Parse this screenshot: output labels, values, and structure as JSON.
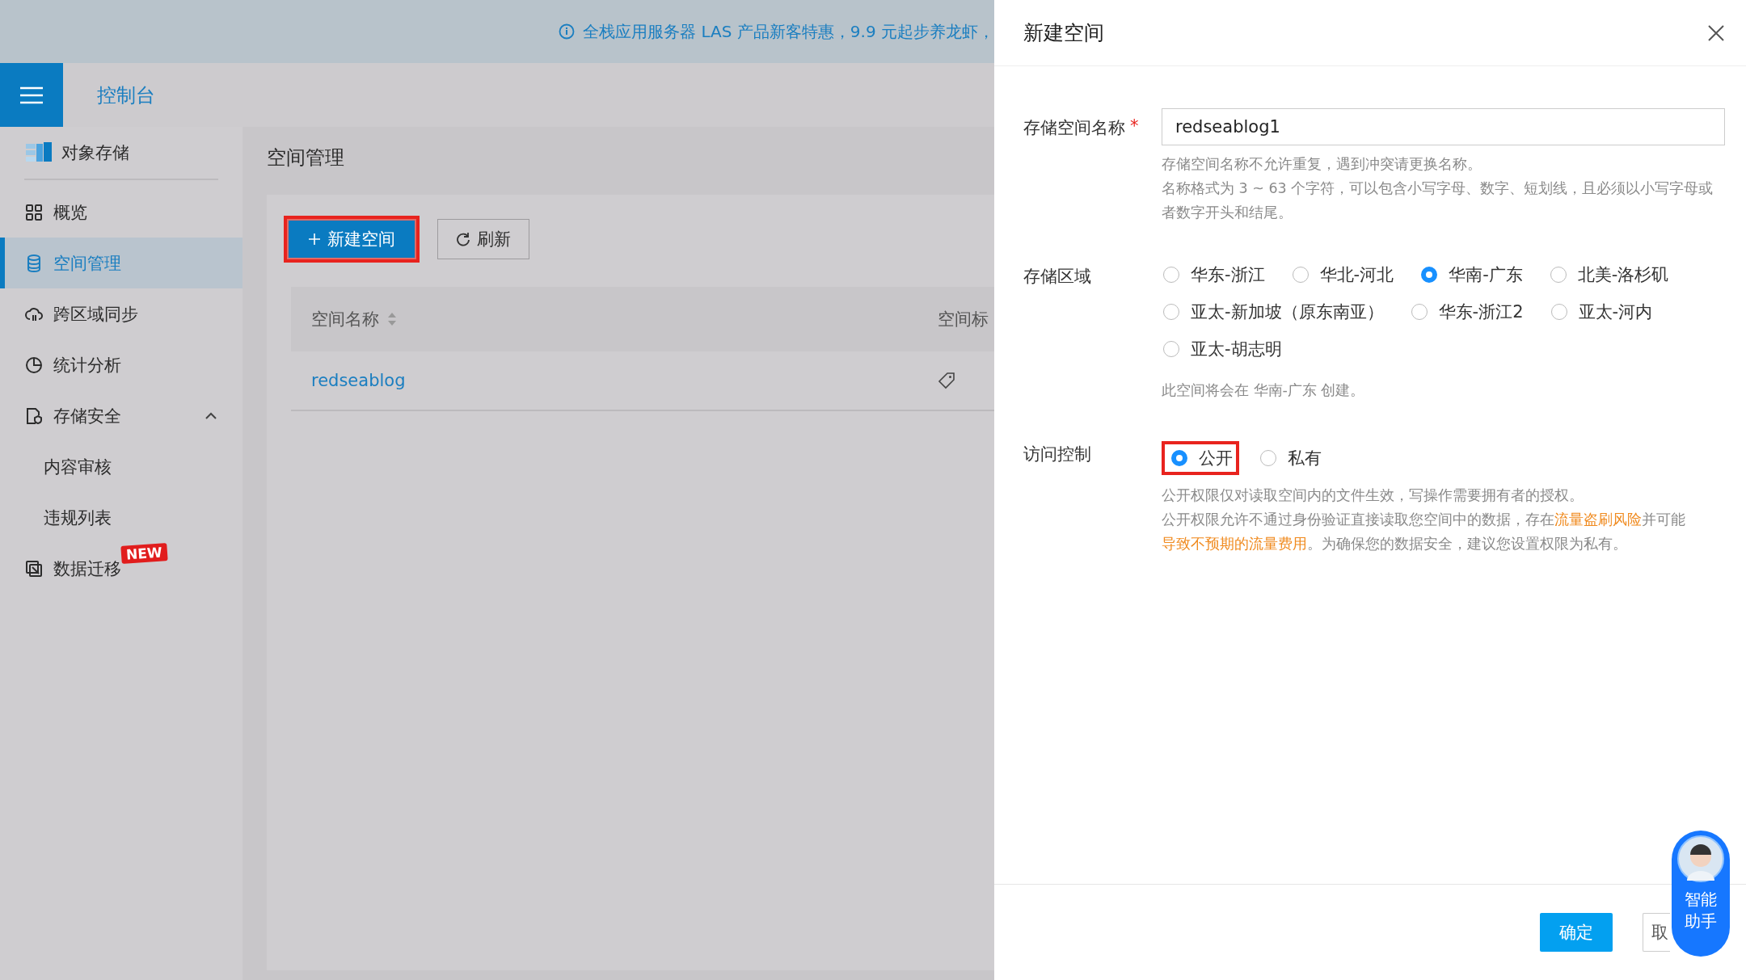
{
  "banner": {
    "text": "全栈应用服务器 LAS 产品新客特惠，9.9 元起步养龙虾，"
  },
  "header": {
    "title": "控制台"
  },
  "sidebar": {
    "product": "对象存储",
    "items": [
      {
        "label": "概览",
        "selected": false
      },
      {
        "label": "空间管理",
        "selected": true
      },
      {
        "label": "跨区域同步",
        "selected": false
      },
      {
        "label": "统计分析",
        "selected": false
      },
      {
        "label": "存储安全",
        "selected": false,
        "expanded": true,
        "children": [
          {
            "label": "内容审核",
            "selected": false
          },
          {
            "label": "违规列表",
            "selected": false
          }
        ]
      },
      {
        "label": "数据迁移",
        "selected": false,
        "badge": "NEW"
      }
    ]
  },
  "page": {
    "title": "空间管理",
    "buttons": [
      {
        "kind": "primary",
        "label": "新建空间",
        "highlighted": true
      },
      {
        "kind": "refresh",
        "label": "刷新",
        "highlighted": false
      }
    ],
    "table": {
      "columns": [
        "空间名称",
        "空间标"
      ],
      "rows": [
        [
          "redseablog"
        ]
      ]
    }
  },
  "drawer": {
    "title": "新建空间",
    "name_field": {
      "label": "存储空间名称",
      "required": "*",
      "value": "redseablog1",
      "help": [
        "存储空间名称不允许重复，遇到冲突请更换名称。",
        "名称格式为 3 ~ 63 个字符，可以包含小写字母、数字、短划线，且必须以小写字母或者数字开头和结尾。"
      ]
    },
    "region": {
      "label": "存储区域",
      "options": [
        {
          "label": "华东-浙江",
          "selected": false
        },
        {
          "label": "华北-河北",
          "selected": false
        },
        {
          "label": "华南-广东",
          "selected": true
        },
        {
          "label": "北美-洛杉矶",
          "selected": false
        },
        {
          "label": "亚太-新加坡（原东南亚）",
          "selected": false
        },
        {
          "label": "华东-浙江2",
          "selected": false
        },
        {
          "label": "亚太-河内",
          "selected": false
        },
        {
          "label": "亚太-胡志明",
          "selected": false
        }
      ],
      "help": "此空间将会在 华南-广东 创建。"
    },
    "access": {
      "label": "访问控制",
      "options": [
        {
          "label": "公开",
          "selected": true,
          "highlighted": true
        },
        {
          "label": "私有",
          "selected": false,
          "highlighted": false
        }
      ],
      "help": "公开权限仅对读取空间内的文件生效，写操作需要拥有者的授权。",
      "warning": [
        {
          "kind": "text",
          "text": "公开权限允许不通过身份验证直接读取您空间中的数据，存在"
        },
        {
          "kind": "link",
          "text": "流量盗刷风险"
        },
        {
          "kind": "text",
          "text": "并可能"
        },
        {
          "kind": "link",
          "text": "导致不预期的流量费用"
        },
        {
          "kind": "text",
          "text": "。为确保您的数据安全，建议您设置权限为私有。"
        }
      ]
    },
    "footer": {
      "confirm": "确定",
      "cancel": "取"
    }
  },
  "assistant": {
    "label": "智能助手"
  }
}
